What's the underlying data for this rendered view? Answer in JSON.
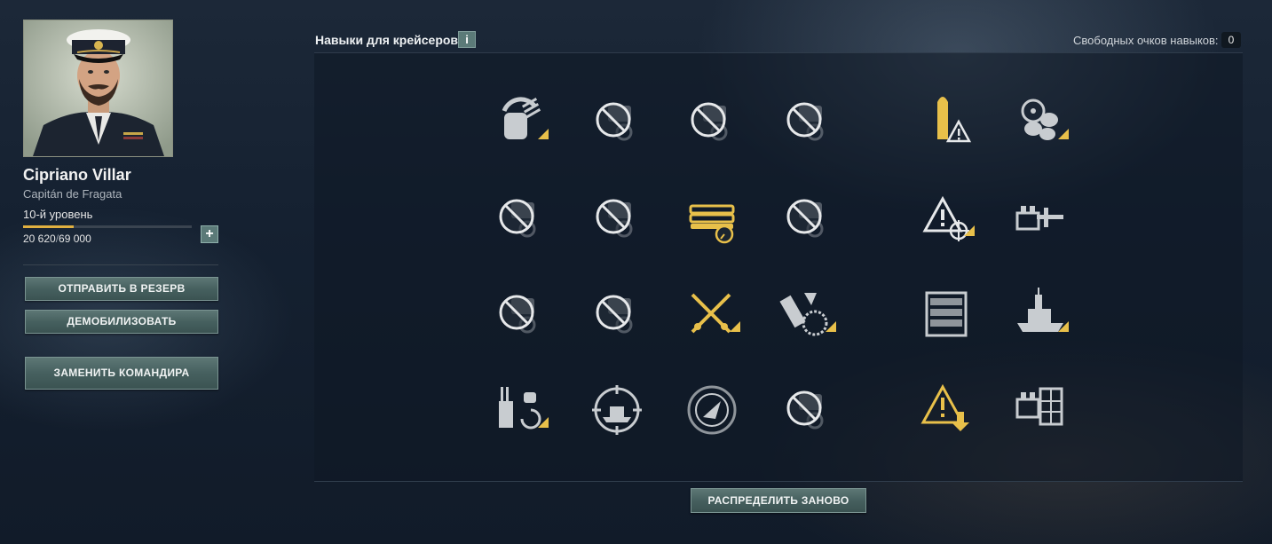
{
  "commander": {
    "name": "Cipriano Villar",
    "rank": "Capitán de Fragata",
    "level": "10-й уровень",
    "xp_current": "20 620",
    "xp_separator": "/",
    "xp_max": "69 000",
    "xp_progress": 0.299,
    "add_xp_symbol": "+"
  },
  "actions": {
    "reserve": "ОТПРАВИТЬ В РЕЗЕРВ",
    "demobilize": "ДЕМОБИЛИЗОВАТЬ",
    "replace": "ЗАМЕНИТЬ КОМАНДИРА",
    "redistribute": "РАСПРЕДЕЛИТЬ ЗАНОВО"
  },
  "skills_header": {
    "title": "Навыки для крейсеров",
    "info_symbol": "i",
    "free_points_label": "Свободных очков навыков:",
    "free_points": "0"
  },
  "colors": {
    "accent_gold": "#e8c04a",
    "button_teal": "#4f6968",
    "icon_grey": "#c8ccd0"
  },
  "skills": [
    {
      "icon": "turret-traverse-icon",
      "state": "active"
    },
    {
      "icon": "disabled-skill-icon",
      "state": "disabled"
    },
    {
      "icon": "disabled-skill-icon",
      "state": "disabled"
    },
    {
      "icon": "disabled-skill-icon",
      "state": "disabled"
    },
    {
      "icon": "he-shell-warning-icon",
      "state": "learned"
    },
    {
      "icon": "steering-gears-icon",
      "state": "active"
    },
    {
      "icon": "disabled-skill-icon",
      "state": "disabled"
    },
    {
      "icon": "disabled-skill-icon",
      "state": "disabled"
    },
    {
      "icon": "torpedo-tubes-icon",
      "state": "learned"
    },
    {
      "icon": "disabled-skill-icon",
      "state": "disabled"
    },
    {
      "icon": "detection-warning-icon",
      "state": "active"
    },
    {
      "icon": "catapult-aircraft-icon",
      "state": "active"
    },
    {
      "icon": "disabled-skill-icon",
      "state": "disabled"
    },
    {
      "icon": "disabled-skill-icon",
      "state": "disabled"
    },
    {
      "icon": "crossed-guns-icon",
      "state": "learned"
    },
    {
      "icon": "aa-defense-icon",
      "state": "active"
    },
    {
      "icon": "armor-plating-icon",
      "state": "active"
    },
    {
      "icon": "battleship-hull-icon",
      "state": "active"
    },
    {
      "icon": "main-battery-reload-icon",
      "state": "active"
    },
    {
      "icon": "target-ship-icon",
      "state": "active"
    },
    {
      "icon": "radar-icon",
      "state": "active"
    },
    {
      "icon": "disabled-skill-icon",
      "state": "disabled"
    },
    {
      "icon": "warning-fire-icon",
      "state": "learned"
    },
    {
      "icon": "ship-armor-icon",
      "state": "active"
    }
  ]
}
